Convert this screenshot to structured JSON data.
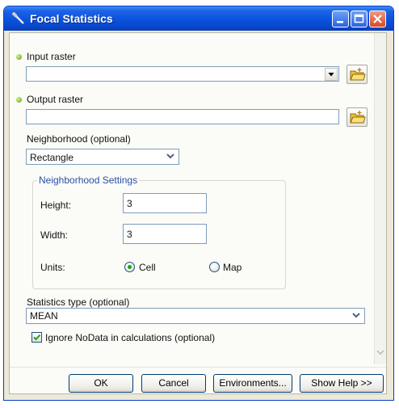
{
  "window": {
    "title": "Focal Statistics"
  },
  "input_raster": {
    "label": "Input raster",
    "value": ""
  },
  "output_raster": {
    "label": "Output raster",
    "value": ""
  },
  "neighborhood": {
    "label": "Neighborhood (optional)",
    "value": "Rectangle"
  },
  "neighborhood_settings": {
    "title": "Neighborhood Settings",
    "height_label": "Height:",
    "height_value": "3",
    "width_label": "Width:",
    "width_value": "3",
    "units_label": "Units:",
    "unit_cell": "Cell",
    "unit_map": "Map",
    "selected_unit": "Cell"
  },
  "statistics_type": {
    "label": "Statistics type (optional)",
    "value": "MEAN"
  },
  "ignore_nodata": {
    "label": "Ignore NoData in calculations (optional)",
    "checked": true
  },
  "buttons": {
    "ok": "OK",
    "cancel": "Cancel",
    "environments": "Environments...",
    "show_help": "Show Help >>"
  },
  "colors": {
    "titlebar": "#0a55e0",
    "required_dot": "#5a9a10",
    "group_title": "#2b4ea8"
  }
}
